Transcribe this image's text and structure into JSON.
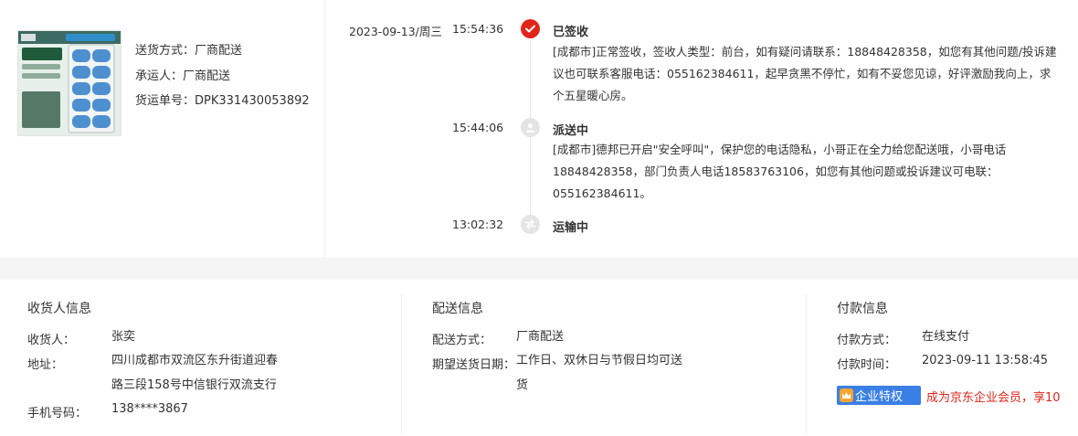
{
  "shipping": {
    "method": "送货方式：厂商配送",
    "carrier": "承运人：厂商配送",
    "tracking": "货运单号：DPK331430053892"
  },
  "timeline": {
    "date": "2023-09-13/周三",
    "events": [
      {
        "time": "15:54:36",
        "status": "已签收",
        "desc_lines": [
          "[成都市]正常签收，签收人类型：前台，如有疑问请联系：18848428358，如您有其他问题/投诉建",
          "议也可联系客服电话：055162384611，起早贪黑不停忙，如有不妥您见谅，好评激励我向上，求",
          "个五星暖心房。"
        ]
      },
      {
        "time": "15:44:06",
        "status": "派送中",
        "desc_lines": [
          "[成都市]德邦已开启\"安全呼叫\"，保护您的电话隐私，小哥正在全力给您配送哦，小哥电话",
          "18848428358，部门负责人电话18583763106，如您有其他问题或投诉建议可电联：",
          "055162384611。"
        ]
      },
      {
        "time": "13:02:32",
        "status": "运输中",
        "desc_lines": []
      }
    ]
  },
  "receiver": {
    "title": "收货人信息",
    "name_label": "收货人：",
    "name": "张奕",
    "address_label": "地址：",
    "address_lines": [
      "四川成都市双流区东升街道迎春",
      "路三段158号中信银行双流支行"
    ],
    "phone_label": "手机号码：",
    "phone": "138****3867"
  },
  "delivery": {
    "title": "配送信息",
    "method_label": "配送方式：",
    "method": "厂商配送",
    "date_label": "期望送货日期：",
    "date_lines": [
      "工作日、双休日与节假日均可送",
      "货"
    ]
  },
  "payment": {
    "title": "付款信息",
    "method_label": "付款方式：",
    "method": "在线支付",
    "time_label": "付款时间：",
    "time": "2023-09-11 13:58:45",
    "badge": "企业特权",
    "promo": "成为京东企业会员，享10"
  },
  "colors": {
    "accent": "#e1251b",
    "badge_blue": "#3a7fe6"
  }
}
